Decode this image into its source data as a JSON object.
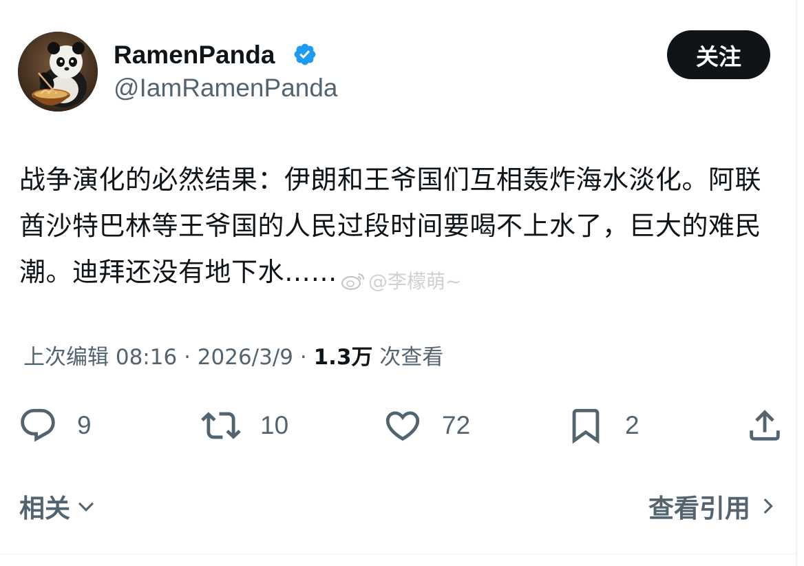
{
  "author": {
    "display_name": "RamenPanda",
    "handle": "@IamRamenPanda",
    "verified": true,
    "avatar_icon": "panda-eating-ramen-avatar"
  },
  "follow_label": "关注",
  "tweet": {
    "text": "战争演化的必然结果：伊朗和王爷国们互相轰炸海水淡化。阿联酋沙特巴林等王爷国的人民过段时间要喝不上水了，巨大的难民潮。迪拜还没有地下水……"
  },
  "watermark": {
    "text": "@李檬萌~",
    "icon": "weibo-logo-icon"
  },
  "meta": {
    "edited_label": "上次编辑",
    "time": "08:16",
    "date": "2026/3/9",
    "views_count": "1.3万",
    "views_label": "次查看"
  },
  "actions": {
    "reply": {
      "icon": "reply-icon",
      "count": "9"
    },
    "repost": {
      "icon": "repost-icon",
      "count": "10"
    },
    "like": {
      "icon": "heart-icon",
      "count": "72"
    },
    "bookmark": {
      "icon": "bookmark-icon",
      "count": "2"
    },
    "share": {
      "icon": "share-icon"
    }
  },
  "footer": {
    "related_label": "相关",
    "quotes_label": "查看引用"
  },
  "colors": {
    "text_primary": "#0f1419",
    "text_secondary": "#536471",
    "verified_blue": "#1d9bf0",
    "button_bg": "#0f1419"
  }
}
